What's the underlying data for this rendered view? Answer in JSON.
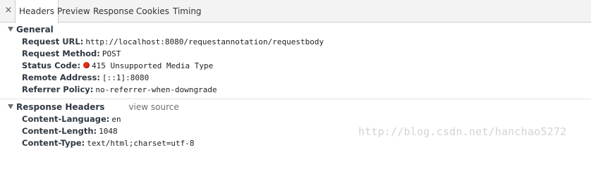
{
  "tabs": {
    "close_glyph": "×",
    "items": [
      "Headers",
      "Preview",
      "Response",
      "Cookies",
      "Timing"
    ],
    "active": "Headers"
  },
  "general": {
    "title": "General",
    "rows": [
      {
        "key": "Request URL:",
        "value": "http://localhost:8080/requestannotation/requestbody"
      },
      {
        "key": "Request Method:",
        "value": "POST"
      },
      {
        "key": "Status Code:",
        "value": "415 Unsupported Media Type",
        "status_color": "#e32b16"
      },
      {
        "key": "Remote Address:",
        "value": "[::1]:8080"
      },
      {
        "key": "Referrer Policy:",
        "value": "no-referrer-when-downgrade"
      }
    ]
  },
  "response_headers": {
    "title": "Response Headers",
    "view_source": "view source",
    "rows": [
      {
        "key": "Content-Language:",
        "value": "en"
      },
      {
        "key": "Content-Length:",
        "value": "1048"
      },
      {
        "key": "Content-Type:",
        "value": "text/html;charset=utf-8"
      }
    ]
  },
  "watermark": "http://blog.csdn.net/hanchao5272"
}
